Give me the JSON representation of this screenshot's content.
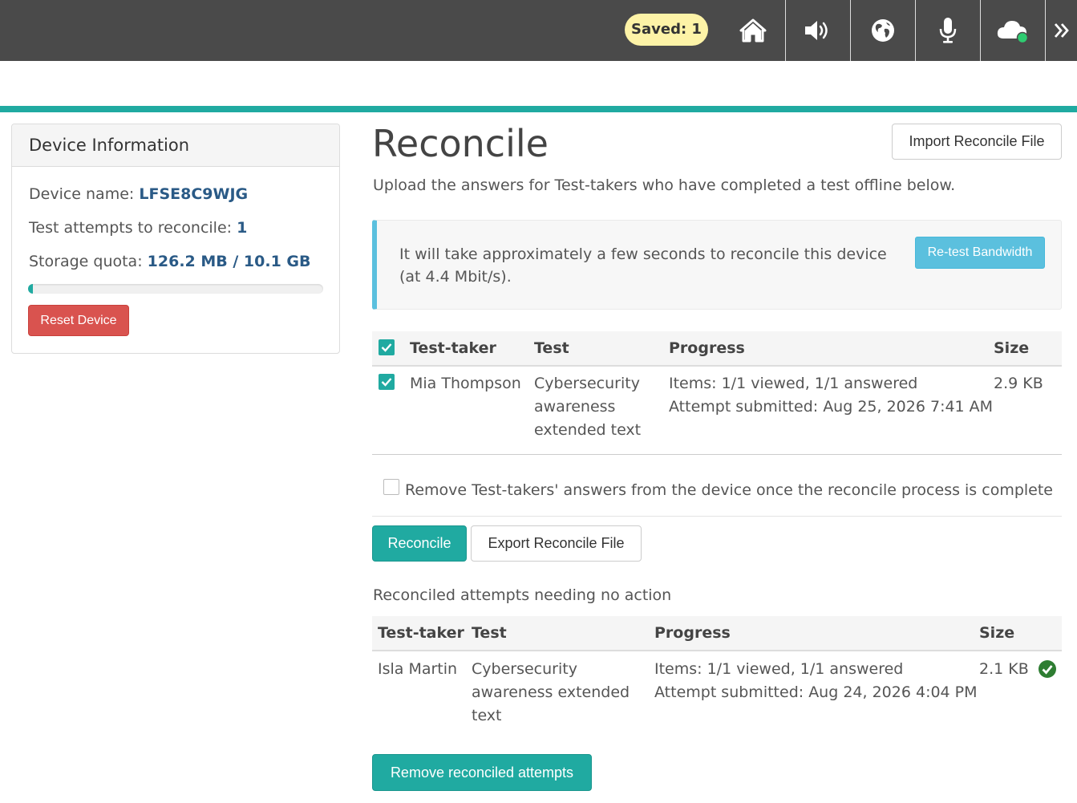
{
  "topbar": {
    "saved_label": "Saved: 1",
    "icons": [
      "home-icon",
      "volume-icon",
      "globe-icon",
      "microphone-icon",
      "cloud-status-icon",
      "double-chevron-right-icon"
    ],
    "bg_color": "#4a4a4a",
    "badge_color": "#fdf3a7",
    "cloud_status_color": "#2ecc71"
  },
  "accent_color": "#20aaa1",
  "device": {
    "title": "Device Information",
    "name_label": "Device name:",
    "name_value": "LFSE8C9WJG",
    "attempts_label": "Test attempts to reconcile:",
    "attempts_value": "1",
    "storage_label": "Storage quota:",
    "storage_value": "126.2 MB / 10.1 GB",
    "storage_used_fraction": 0.0125,
    "reset_label": "Reset Device"
  },
  "main": {
    "title": "Reconcile",
    "import_label": "Import Reconcile File",
    "subtitle": "Upload the answers for Test-takers who have completed a test offline below.",
    "info_text": "It will take approximately a few seconds to reconcile this device (at 4.4 Mbit/s).",
    "retest_label": "Re-test Bandwidth",
    "table": {
      "headers": {
        "taker": "Test-taker",
        "test": "Test",
        "progress": "Progress",
        "size": "Size"
      },
      "header_checked": true,
      "rows": [
        {
          "checked": true,
          "taker": "Mia Thompson",
          "test_lines": [
            "Cybersecurity",
            "awareness",
            "extended text"
          ],
          "progress_lines": [
            "Items: 1/1 viewed, 1/1 answered",
            "Attempt submitted: Aug 25, 2026 7:41 AM"
          ],
          "size": "2.9 KB"
        }
      ]
    },
    "remove_option_label": "Remove Test-takers' answers from the device once the reconcile process is complete",
    "remove_option_checked": false,
    "reconcile_label": "Reconcile",
    "export_label": "Export Reconcile File",
    "reconciled_heading": "Reconciled attempts needing no action",
    "reconciled_table": {
      "headers": {
        "taker": "Test-taker",
        "test": "Test",
        "progress": "Progress",
        "size": "Size"
      },
      "rows": [
        {
          "taker": "Isla Martin",
          "test_lines": [
            "Cybersecurity",
            "awareness extended",
            "text"
          ],
          "progress_lines": [
            "Items: 1/1 viewed, 1/1 answered",
            "Attempt submitted: Aug 24, 2026 4:04 PM"
          ],
          "size": "2.1 KB",
          "status_icon": "check-circle-icon"
        }
      ]
    },
    "remove_reconciled_label": "Remove reconciled attempts"
  }
}
